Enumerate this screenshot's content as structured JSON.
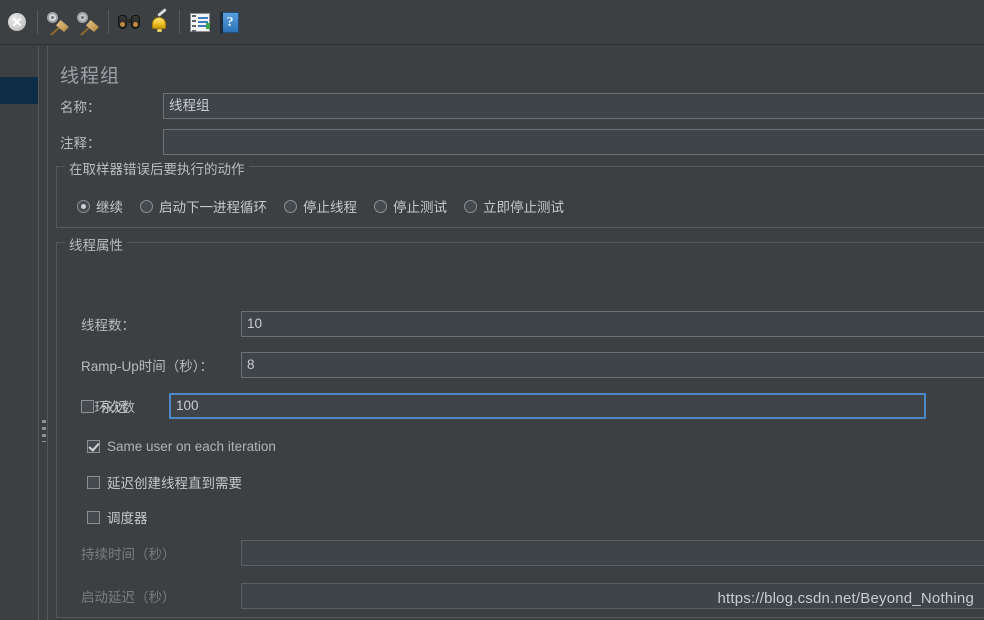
{
  "toolbar": {
    "buttons": [
      {
        "name": "stop-button",
        "icon": "stop-icon",
        "label": "停止"
      },
      {
        "name": "clear-button",
        "icon": "clear-broom-icon",
        "label": "清除"
      },
      {
        "name": "clear-all-button",
        "icon": "clear-all-broom-icon",
        "label": "清除全部"
      },
      {
        "name": "search-button",
        "icon": "binoculars-icon",
        "label": "搜索"
      },
      {
        "name": "reset-search-button",
        "icon": "bell-broom-icon",
        "label": "重置搜索"
      },
      {
        "name": "function-helper-button",
        "icon": "notepad-icon",
        "label": "函数助手对话框"
      },
      {
        "name": "help-button",
        "icon": "help-book-icon",
        "label": "帮助"
      }
    ]
  },
  "panel": {
    "title": "线程组",
    "name_label": "名称：",
    "name_value": "线程组",
    "comment_label": "注释：",
    "comment_value": ""
  },
  "error_action": {
    "title": "在取样器错误后要执行的动作",
    "options": [
      {
        "label": "继续",
        "checked": true
      },
      {
        "label": "启动下一进程循环",
        "checked": false
      },
      {
        "label": "停止线程",
        "checked": false
      },
      {
        "label": "停止测试",
        "checked": false
      },
      {
        "label": "立即停止测试",
        "checked": false
      }
    ]
  },
  "thread_properties": {
    "title": "线程属性",
    "threads_label": "线程数：",
    "threads_value": "10",
    "ramp_label": "Ramp-Up时间（秒）：",
    "ramp_value": "8",
    "loop_label": "循环次数",
    "forever_label": "永远",
    "forever_checked": false,
    "loop_value": "100",
    "same_user_label": "Same user on each iteration",
    "same_user_checked": true,
    "delayed_start_label": "延迟创建线程直到需要",
    "delayed_start_checked": false,
    "scheduler_label": "调度器",
    "scheduler_checked": false,
    "duration_label": "持续时间（秒）",
    "duration_value": "",
    "startup_delay_label": "启动延迟（秒）",
    "startup_delay_value": "",
    "focus_accent_color": "#4a87c4"
  },
  "watermark": {
    "text": "https://blog.csdn.net/Beyond_Nothing"
  }
}
